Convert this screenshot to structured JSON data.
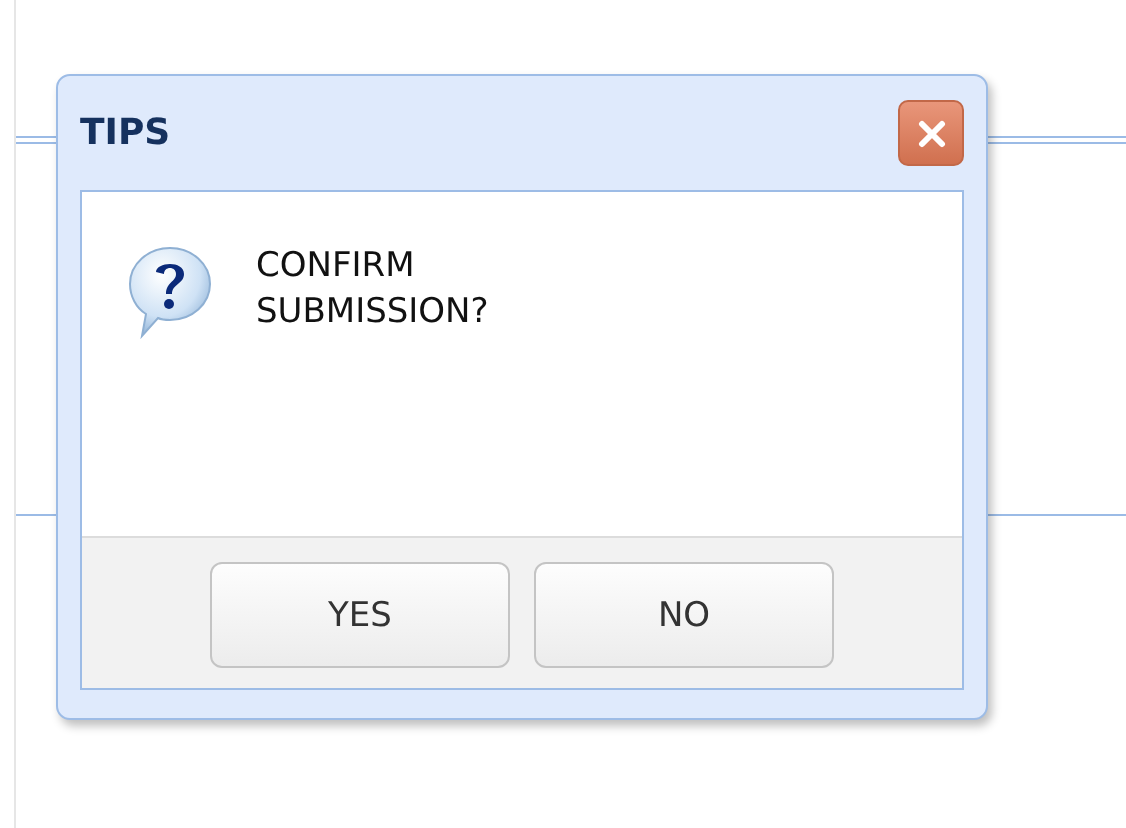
{
  "dialog": {
    "title": "TIPS",
    "message": "CONFIRM SUBMISSION?",
    "buttons": [
      "YES",
      "NO"
    ]
  }
}
